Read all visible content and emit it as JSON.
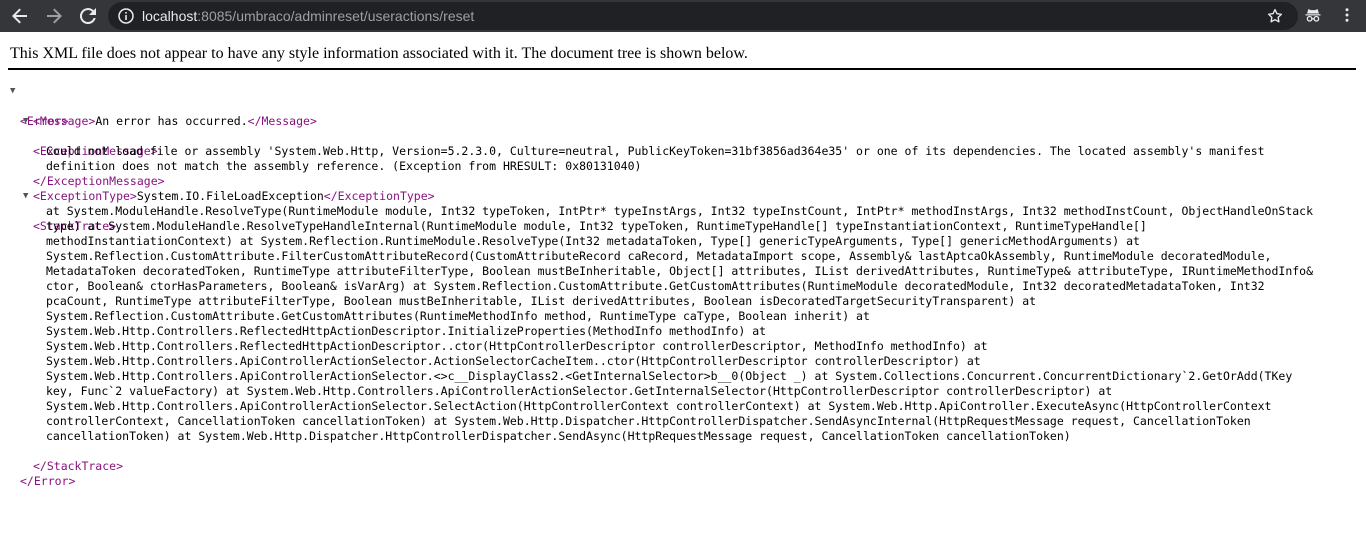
{
  "browser": {
    "url_host": "localhost",
    "url_rest": ":8085/umbraco/adminreset/useractions/reset",
    "back_icon": "arrow-left-icon",
    "forward_icon": "arrow-right-icon",
    "reload_icon": "reload-icon",
    "info_icon": "info-icon",
    "star_icon": "star-icon",
    "incognito_icon": "incognito-icon",
    "menu_icon": "kebab-menu-icon"
  },
  "xml_notice": "This XML file does not appear to have any style information associated with it. The document tree is shown below.",
  "tree": {
    "error_open": "<Error>",
    "error_close": "</Error>",
    "message_open": "<Message>",
    "message_text": "An error has occurred.",
    "message_close": "</Message>",
    "exmsg_open": "<ExceptionMessage>",
    "exmsg_lines": [
      "Could not load file or assembly 'System.Web.Http, Version=5.2.3.0, Culture=neutral, PublicKeyToken=31bf3856ad364e35' or one of its dependencies. The located assembly's manifest",
      "definition does not match the assembly reference. (Exception from HRESULT: 0x80131040)"
    ],
    "exmsg_close": "</ExceptionMessage>",
    "extype_open": "<ExceptionType>",
    "extype_text": "System.IO.FileLoadException",
    "extype_close": "</ExceptionType>",
    "stack_open": "<StackTrace>",
    "stack_lines": [
      "at System.ModuleHandle.ResolveType(RuntimeModule module, Int32 typeToken, IntPtr* typeInstArgs, Int32 typeInstCount, IntPtr* methodInstArgs, Int32 methodInstCount, ObjectHandleOnStack",
      "type) at System.ModuleHandle.ResolveTypeHandleInternal(RuntimeModule module, Int32 typeToken, RuntimeTypeHandle[] typeInstantiationContext, RuntimeTypeHandle[]",
      "methodInstantiationContext) at System.Reflection.RuntimeModule.ResolveType(Int32 metadataToken, Type[] genericTypeArguments, Type[] genericMethodArguments) at",
      "System.Reflection.CustomAttribute.FilterCustomAttributeRecord(CustomAttributeRecord caRecord, MetadataImport scope, Assembly& lastAptcaOkAssembly, RuntimeModule decoratedModule,",
      "MetadataToken decoratedToken, RuntimeType attributeFilterType, Boolean mustBeInheritable, Object[] attributes, IList derivedAttributes, RuntimeType& attributeType, IRuntimeMethodInfo&",
      "ctor, Boolean& ctorHasParameters, Boolean& isVarArg) at System.Reflection.CustomAttribute.GetCustomAttributes(RuntimeModule decoratedModule, Int32 decoratedMetadataToken, Int32",
      "pcaCount, RuntimeType attributeFilterType, Boolean mustBeInheritable, IList derivedAttributes, Boolean isDecoratedTargetSecurityTransparent) at",
      "System.Reflection.CustomAttribute.GetCustomAttributes(RuntimeMethodInfo method, RuntimeType caType, Boolean inherit) at",
      "System.Web.Http.Controllers.ReflectedHttpActionDescriptor.InitializeProperties(MethodInfo methodInfo) at",
      "System.Web.Http.Controllers.ReflectedHttpActionDescriptor..ctor(HttpControllerDescriptor controllerDescriptor, MethodInfo methodInfo) at",
      "System.Web.Http.Controllers.ApiControllerActionSelector.ActionSelectorCacheItem..ctor(HttpControllerDescriptor controllerDescriptor) at",
      "System.Web.Http.Controllers.ApiControllerActionSelector.<>c__DisplayClass2.<GetInternalSelector>b__0(Object _) at System.Collections.Concurrent.ConcurrentDictionary`2.GetOrAdd(TKey",
      "key, Func`2 valueFactory) at System.Web.Http.Controllers.ApiControllerActionSelector.GetInternalSelector(HttpControllerDescriptor controllerDescriptor) at",
      "System.Web.Http.Controllers.ApiControllerActionSelector.SelectAction(HttpControllerContext controllerContext) at System.Web.Http.ApiController.ExecuteAsync(HttpControllerContext",
      "controllerContext, CancellationToken cancellationToken) at System.Web.Http.Dispatcher.HttpControllerDispatcher.SendAsyncInternal(HttpRequestMessage request, CancellationToken",
      "cancellationToken) at System.Web.Http.Dispatcher.HttpControllerDispatcher.SendAsync(HttpRequestMessage request, CancellationToken cancellationToken)"
    ],
    "stack_close": "</StackTrace>",
    "toggle_icon": "triangle-down-icon"
  }
}
